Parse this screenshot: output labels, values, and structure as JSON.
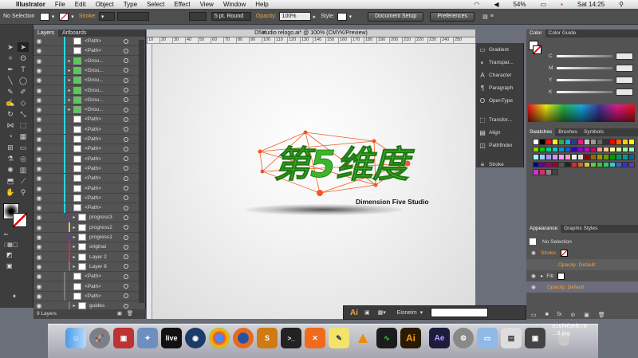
{
  "menubar": {
    "app": "Illustrator",
    "items": [
      "File",
      "Edit",
      "Object",
      "Type",
      "Select",
      "Effect",
      "View",
      "Window",
      "Help"
    ],
    "battery": "54%",
    "clock": "Sat 14:25"
  },
  "control": {
    "selection": "No Selection",
    "stroke_label": "Stroke:",
    "brush": "5 pt. Round",
    "opacity_label": "Opacity:",
    "opacity_value": "100%",
    "style_label": "Style:",
    "doc_setup": "Document Setup",
    "preferences": "Preferences"
  },
  "layers": {
    "tabs": [
      "Layers",
      "Artboards"
    ],
    "rows": [
      {
        "name": "<Path>",
        "color": "#2ad6e6",
        "thumb": "w"
      },
      {
        "name": "<Path>",
        "color": "#2ad6e6",
        "thumb": "w"
      },
      {
        "name": "<Grou...",
        "color": "#2ad6e6",
        "thumb": "g"
      },
      {
        "name": "<Grou...",
        "color": "#2ad6e6",
        "thumb": "g"
      },
      {
        "name": "<Grou...",
        "color": "#2ad6e6",
        "thumb": "g"
      },
      {
        "name": "<Grou...",
        "color": "#2ad6e6",
        "thumb": "g"
      },
      {
        "name": "<Grou...",
        "color": "#2ad6e6",
        "thumb": "g"
      },
      {
        "name": "<Grou...",
        "color": "#2ad6e6",
        "thumb": "g"
      },
      {
        "name": "<Path>",
        "color": "#2ad6e6",
        "thumb": "w"
      },
      {
        "name": "<Path>",
        "color": "#2ad6e6",
        "thumb": "w"
      },
      {
        "name": "<Path>",
        "color": "#2ad6e6",
        "thumb": "w"
      },
      {
        "name": "<Path>",
        "color": "#2ad6e6",
        "thumb": "w"
      },
      {
        "name": "<Path>",
        "color": "#2ad6e6",
        "thumb": "w"
      },
      {
        "name": "<Path>",
        "color": "#2ad6e6",
        "thumb": "w"
      },
      {
        "name": "<Path>",
        "color": "#2ad6e6",
        "thumb": "w"
      },
      {
        "name": "<Path>",
        "color": "#2ad6e6",
        "thumb": "w"
      },
      {
        "name": "<Path>",
        "color": "#2ad6e6",
        "thumb": "w"
      },
      {
        "name": "<Path>",
        "color": "#2ad6e6",
        "thumb": "w"
      },
      {
        "name": "progress3",
        "color": "#7a2ad6",
        "thumb": "w"
      },
      {
        "name": "progress2",
        "color": "#e6c92a",
        "thumb": "w"
      },
      {
        "name": "progress1",
        "color": "#7a2ad6",
        "thumb": "w"
      },
      {
        "name": "original",
        "color": "#d62a4a",
        "thumb": "w"
      },
      {
        "name": "Layer 2",
        "color": "#d62a4a",
        "thumb": "w"
      },
      {
        "name": "Layer 8",
        "color": "#7a7a7a",
        "thumb": "w"
      },
      {
        "name": "<Path>",
        "color": "#7a7a7a",
        "thumb": "w"
      },
      {
        "name": "<Path>",
        "color": "#7a7a7a",
        "thumb": "w"
      },
      {
        "name": "<Path>",
        "color": "#7a7a7a",
        "thumb": "w"
      },
      {
        "name": "guides",
        "color": "#7a7a7a",
        "thumb": "w"
      }
    ],
    "footer": "9 Layers"
  },
  "document": {
    "tab_title": "D5studio relogo.ai* @ 100% (CMYK/Preview)",
    "ruler": [
      "10",
      "20",
      "30",
      "40",
      "50",
      "60",
      "70",
      "80",
      "90",
      "100",
      "110",
      "120",
      "130",
      "140",
      "150",
      "160",
      "170",
      "180",
      "190",
      "200",
      "210",
      "220",
      "230",
      "240",
      "250"
    ],
    "logo_text": "第5维度",
    "logo_subtitle": "Dimension Five Studio"
  },
  "mini_panels": [
    "Gradient",
    "Transpar...",
    "Character",
    "Paragraph",
    "OpenType",
    "Transfor...",
    "Align",
    "Pathfinder",
    "Stroke"
  ],
  "color_panel": {
    "tabs": [
      "Color",
      "Color Guide"
    ],
    "channels": [
      "C",
      "M",
      "Y",
      "K"
    ],
    "unit": "%"
  },
  "swatches_panel": {
    "tabs": [
      "Swatches",
      "Brushes",
      "Symbols"
    ]
  },
  "appearance": {
    "tabs": [
      "Appearance",
      "Graphic Styles"
    ],
    "title": "No Selection",
    "stroke": "Stroke:",
    "opacity1": "Opacity: Default",
    "fill": "Fill:",
    "opacity2": "Opacity: Default"
  },
  "bottom_toolbar": {
    "ai_label": "Ai",
    "workspace": "Eisneim"
  },
  "dock": {
    "labels": [
      "live",
      "S",
      "Ai",
      "Ae"
    ]
  },
  "desktop": {
    "file_line1": "916f4f0efe78",
    "file_line2": "...3.jpg"
  }
}
